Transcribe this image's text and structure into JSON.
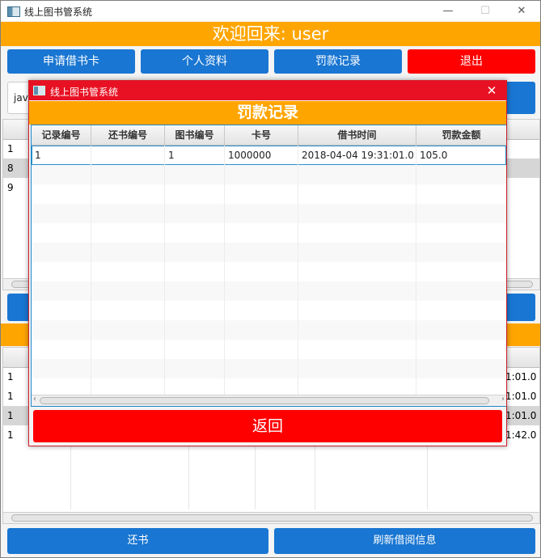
{
  "main_window": {
    "title": "线上图书管系统",
    "controls": {
      "minimize": "—",
      "maximize": "☐",
      "close": "✕"
    },
    "welcome": "欢迎回来: user",
    "buttons": {
      "apply_card": "申请借书卡",
      "profile": "个人资料",
      "fines": "罚款记录",
      "logout": "退出"
    },
    "search_value": "java",
    "bg_rows_top": [
      "1",
      "8",
      "9"
    ],
    "bg_rows_bottom": [
      {
        "id": "1",
        "time": "1:01.0"
      },
      {
        "id": "1",
        "time": "1:01.0"
      },
      {
        "id": "1",
        "time": "1:01.0"
      },
      {
        "id": "1",
        "time": "1:42.0"
      }
    ],
    "bottom_buttons": {
      "return_book": "还书",
      "refresh": "刷新借阅信息"
    }
  },
  "dialog": {
    "title": "线上图书管系统",
    "close": "✕",
    "heading": "罚款记录",
    "columns": [
      "记录编号",
      "还书编号",
      "图书编号",
      "卡号",
      "借书时间",
      "罚款金额"
    ],
    "rows": [
      [
        "1",
        "",
        "1",
        "1000000",
        "2018-04-04 19:31:01.0",
        "105.0"
      ]
    ],
    "back_button": "返回"
  },
  "colors": {
    "accent_orange": "#ffa500",
    "primary_blue": "#1976d2",
    "danger_red": "#ff0000",
    "dialog_titlebar": "#e81123"
  }
}
